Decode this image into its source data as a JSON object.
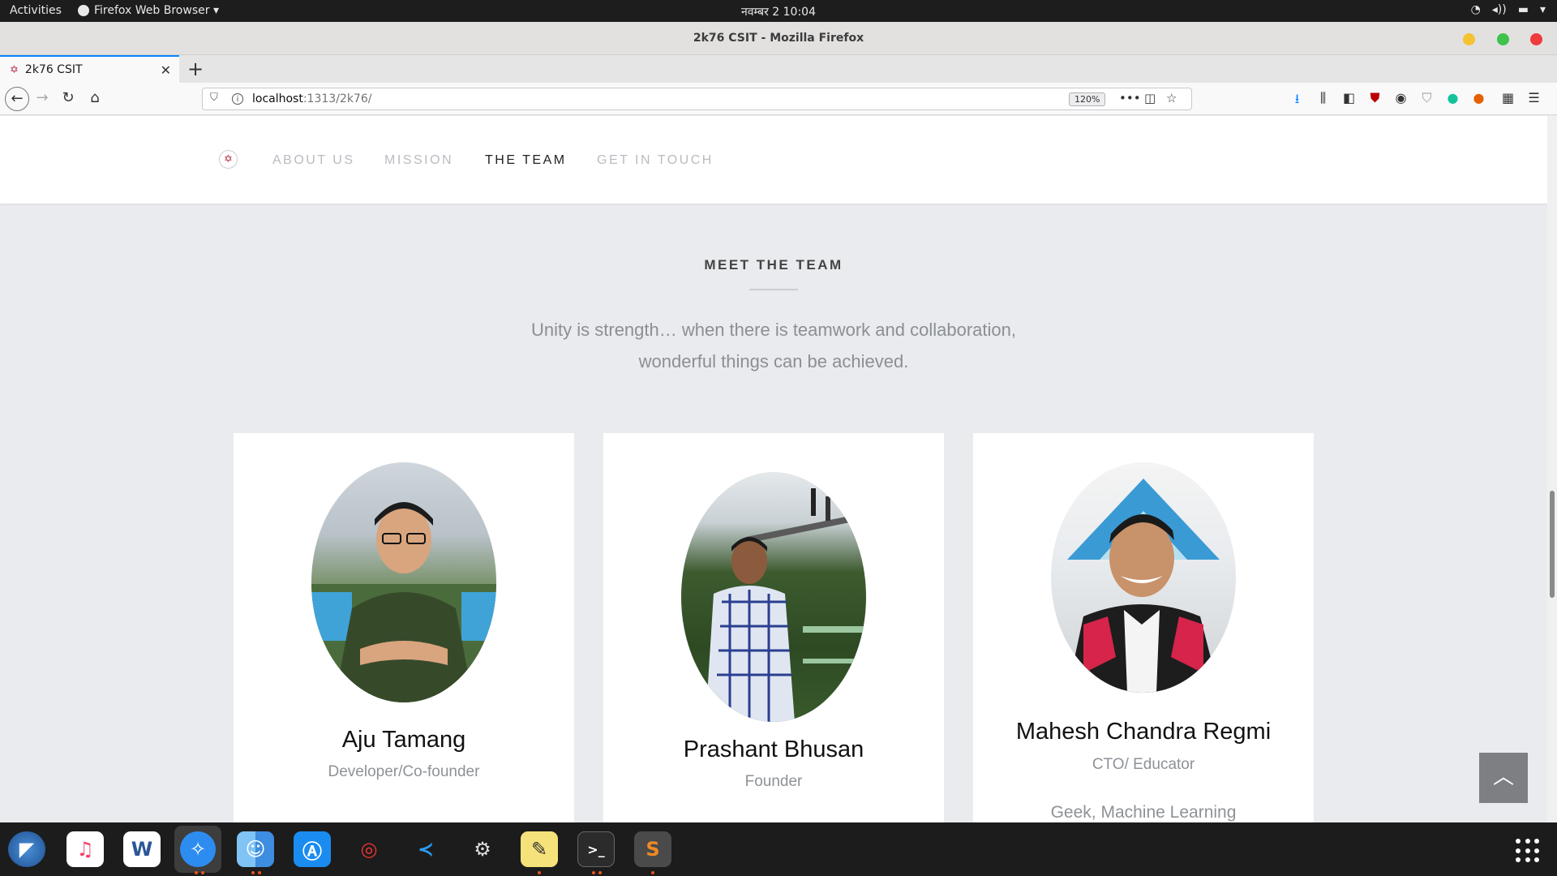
{
  "topbar": {
    "activities": "Activities",
    "app_menu": "Firefox Web Browser ▾",
    "clock": "नवम्बर 2  10:04"
  },
  "window": {
    "title": "2k76 CSIT - Mozilla Firefox"
  },
  "tabs": [
    {
      "label": "2k76 CSIT",
      "active": true
    }
  ],
  "urlbar": {
    "host": "localhost",
    "path": ":1313/2k76/",
    "zoom": "120%"
  },
  "site": {
    "nav": [
      {
        "label": "ABOUT US",
        "active": false
      },
      {
        "label": "MISSION",
        "active": false
      },
      {
        "label": "THE TEAM",
        "active": true
      },
      {
        "label": "GET IN TOUCH",
        "active": false
      }
    ],
    "section_title": "MEET THE TEAM",
    "subtitle_line1": "Unity is strength… when there is teamwork and collaboration,",
    "subtitle_line2": "wonderful things can be achieved.",
    "team": [
      {
        "name": "Aju Tamang",
        "role": "Developer/Co-founder",
        "bio": ""
      },
      {
        "name": "Prashant Bhusan",
        "role": "Founder",
        "bio": ""
      },
      {
        "name": "Mahesh Chandra Regmi",
        "role": "CTO/ Educator",
        "bio": "Geek, Machine Learning"
      }
    ]
  },
  "icons": {
    "back": "arrow-left-icon",
    "forward": "arrow-right-icon",
    "reload": "reload-icon",
    "home": "home-icon",
    "scroll_top": "chevron-up-icon"
  },
  "colors": {
    "page_bg": "#e9ebee",
    "accent_tab": "#0a84ff",
    "brand": "#b32b3f",
    "ubuntu_orange": "#e95420"
  },
  "dock_apps": [
    "eagle-app-icon",
    "music-icon",
    "word-processor-icon",
    "safari-compass-icon",
    "finder-icon",
    "app-store-icon",
    "help-lifebuoy-icon",
    "vscode-icon",
    "settings-gear-icon",
    "notes-pencil-icon",
    "terminal-icon",
    "sublime-text-icon"
  ]
}
